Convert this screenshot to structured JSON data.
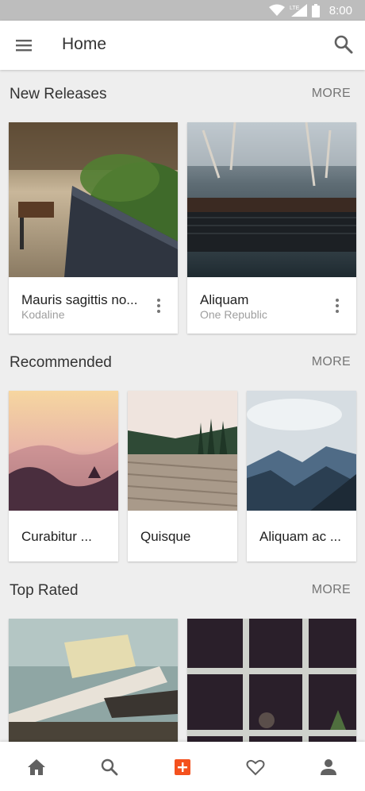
{
  "status_bar": {
    "time": "8:00",
    "network": "LTE"
  },
  "app_bar": {
    "title": "Home",
    "menu_icon": "menu-icon",
    "search_icon": "search-icon"
  },
  "sections": {
    "new_releases": {
      "title": "New Releases",
      "more": "MORE",
      "cards": [
        {
          "title": "Mauris sagittis no...",
          "subtitle": "Kodaline"
        },
        {
          "title": "Aliquam",
          "subtitle": "One Republic"
        }
      ]
    },
    "recommended": {
      "title": "Recommended",
      "more": "MORE",
      "cards": [
        {
          "title": "Curabitur ..."
        },
        {
          "title": "Quisque"
        },
        {
          "title": "Aliquam ac ..."
        }
      ]
    },
    "top_rated": {
      "title": "Top Rated",
      "more": "MORE"
    }
  },
  "bottom_nav": {
    "items": [
      "home-icon",
      "search-icon",
      "add-icon",
      "favorite-icon",
      "account-icon"
    ],
    "accent": "#f4511e"
  }
}
